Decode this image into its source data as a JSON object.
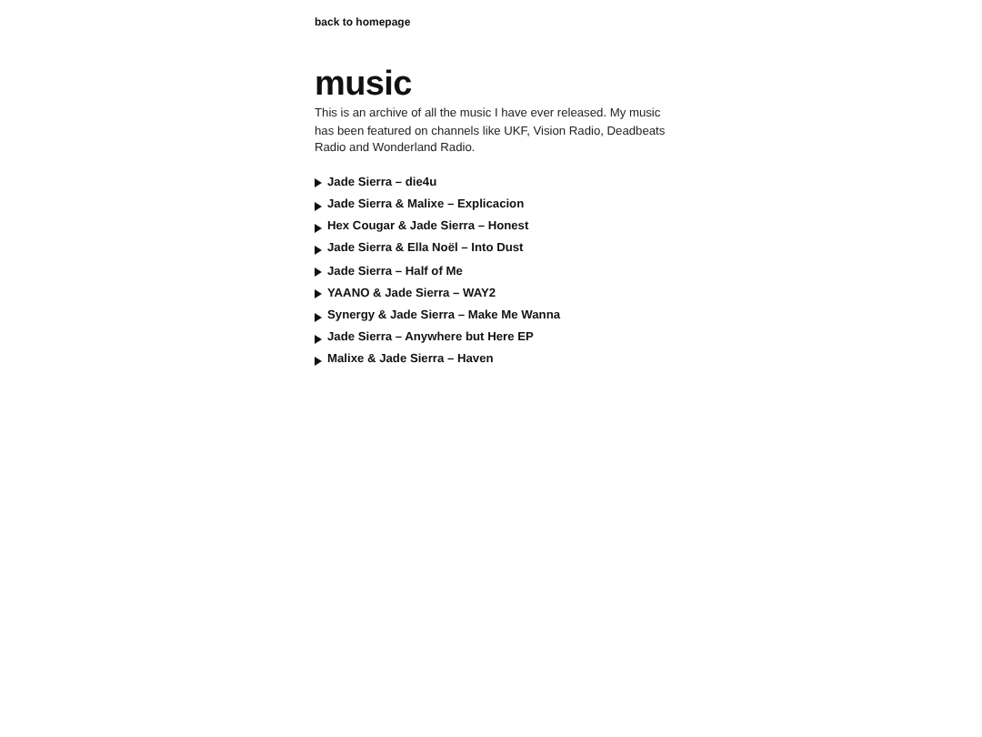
{
  "back_link": "back to homepage",
  "title": "music",
  "description": "This is an archive of all the music I have ever released. My music has been featured on channels like UKF, Vision Radio, Deadbeats Radio and Wonderland Radio.",
  "releases": [
    {
      "label": "Jade Sierra – die4u",
      "expanded": false
    },
    {
      "label": "Jade Sierra & Malixe – Explicacion",
      "expanded": false
    },
    {
      "label": "Hex Cougar & Jade Sierra – Honest",
      "expanded": false
    },
    {
      "label": "Jade Sierra & Ella Noël – Into Dust",
      "expanded": false
    },
    {
      "label": "Jade Sierra – Half of Me",
      "expanded": false
    },
    {
      "label": "YAANO & Jade Sierra – WAY2",
      "expanded": false
    },
    {
      "label": "Synergy & Jade Sierra – Make Me Wanna",
      "expanded": false
    },
    {
      "label": "Jade Sierra – Anywhere but Here EP",
      "expanded": false
    },
    {
      "label": "Malixe & Jade Sierra – Haven",
      "expanded": false
    }
  ]
}
